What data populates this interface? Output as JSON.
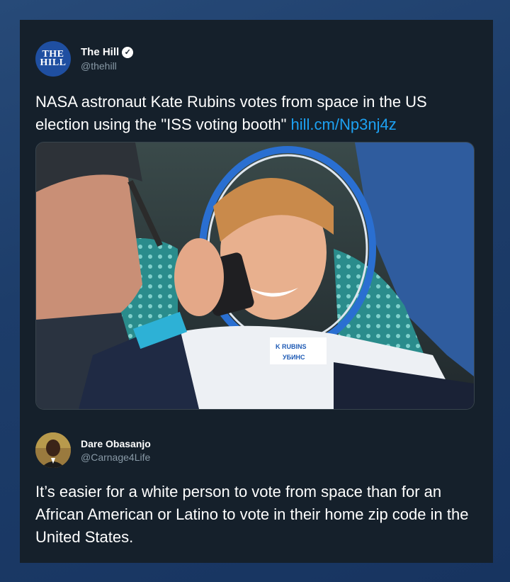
{
  "tweet": {
    "author": {
      "avatar_text_line1": "THE",
      "avatar_text_line2": "HILL",
      "display_name": "The Hill",
      "handle": "@thehill",
      "verified_icon": "verified-check-icon"
    },
    "text": "NASA astronaut Kate Rubins votes from space in the US election using the \"ISS voting booth\"",
    "link": "hill.cm/Np3nj4z",
    "photo": {
      "suit_patch_line1": "K RUBINS",
      "suit_patch_line2": "УБИНС"
    }
  },
  "reply": {
    "author": {
      "display_name": "Dare Obasanjo",
      "handle": "@Carnage4Life"
    },
    "text": "It’s easier for a white person to vote from space than for an African American or Latino to vote in their home zip code in the United States."
  },
  "colors": {
    "card_bg": "#15202b",
    "link": "#1da1f2",
    "muted": "#8899a6",
    "hill_blue": "#1f4fa1"
  }
}
